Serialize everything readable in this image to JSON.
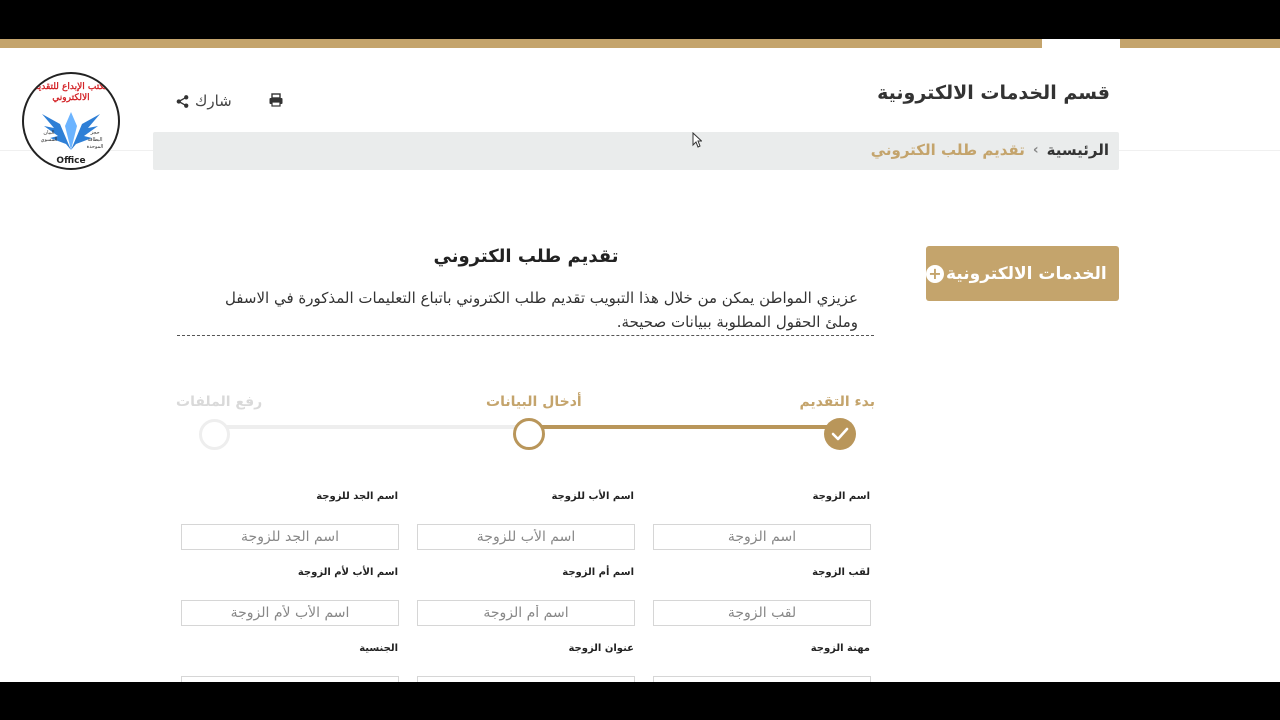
{
  "header": {
    "section_title": "قسم الخدمات الالكترونية",
    "share_label": "شارك"
  },
  "logo": {
    "top_text": "مكتب الإبداع للتقديم الالكتروني",
    "office_text": "Office",
    "side_left": "البيان المسوي",
    "side_right": "حجز البطاقة الموحدة"
  },
  "breadcrumb": {
    "home": "الرئيسية",
    "separator": "›",
    "current": "تقديم طلب الكتروني"
  },
  "sidebar": {
    "eservices_label": "الخدمات الالكترونية",
    "plus": "+"
  },
  "form": {
    "title": "تقديم طلب الكتروني",
    "intro": "عزيزي المواطن يمكن من خلال هذا التبويب تقديم طلب الكتروني باتباع التعليمات المذكورة في الاسفل وملئ الحقول المطلوبة ببيانات صحيحة."
  },
  "steps": [
    {
      "label": "بدء التقديم",
      "state": "done"
    },
    {
      "label": "أدخال البيانات",
      "state": "current"
    },
    {
      "label": "رفع الملفات",
      "state": "pending"
    }
  ],
  "fields": [
    {
      "label": "اسم الزوجة",
      "placeholder": "اسم الزوجة"
    },
    {
      "label": "اسم الأب للزوجة",
      "placeholder": "اسم الأب للزوجة"
    },
    {
      "label": "اسم الجد للزوجة",
      "placeholder": "اسم الجد للزوجة"
    },
    {
      "label": "لقب الزوجة",
      "placeholder": "لقب الزوجة"
    },
    {
      "label": "اسم أم الزوجة",
      "placeholder": "اسم أم الزوجة"
    },
    {
      "label": "اسم الأب لأم الزوجة",
      "placeholder": "اسم الأب لأم الزوجة"
    },
    {
      "label": "مهنة الزوجة",
      "placeholder": ""
    },
    {
      "label": "عنوان الزوجة",
      "placeholder": ""
    },
    {
      "label": "الجنسية",
      "placeholder": ""
    }
  ],
  "colors": {
    "gold": "#c4a46c",
    "gold_dark": "#b9965a",
    "breadcrumb_bg": "#eaecec"
  }
}
